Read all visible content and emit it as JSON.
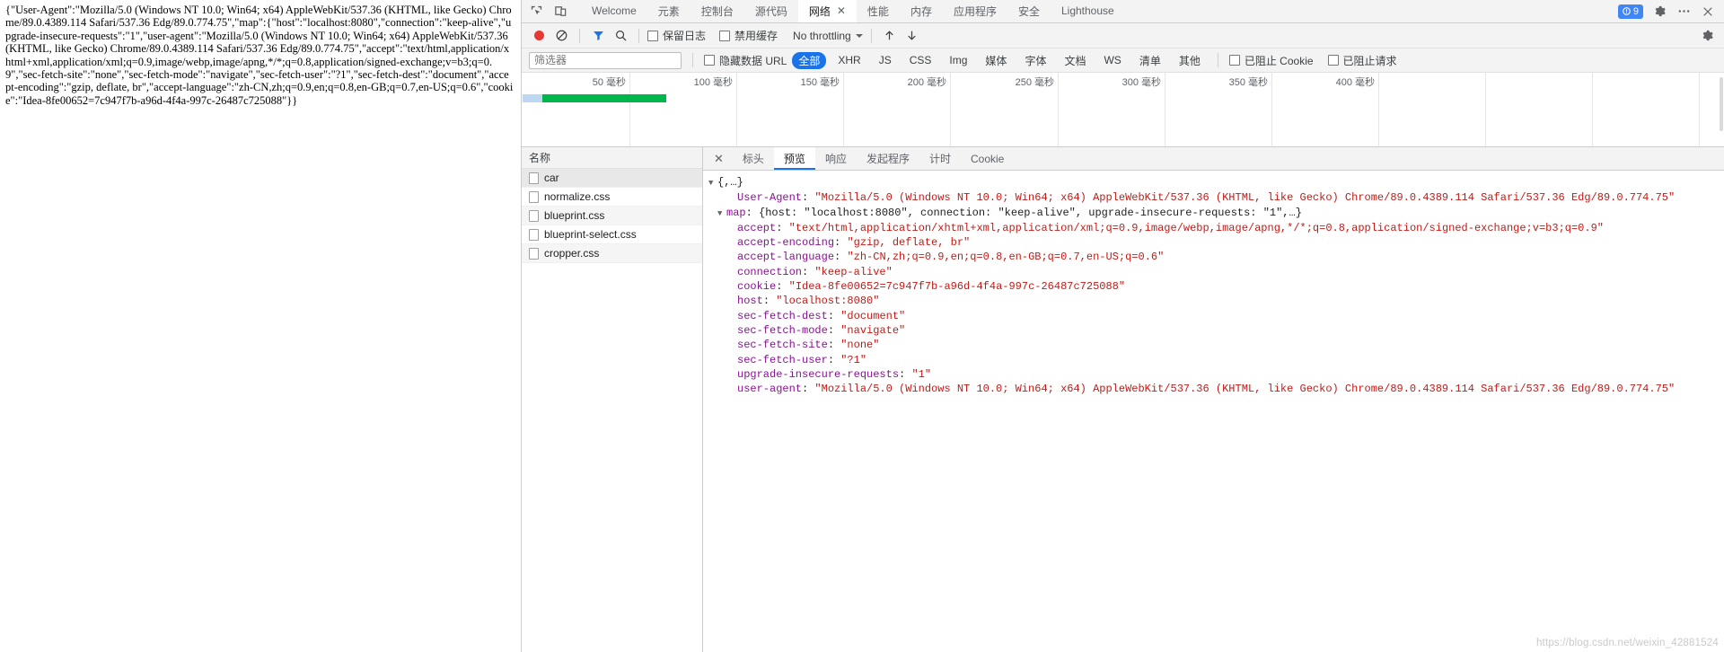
{
  "page": {
    "raw_json": "{\"User-Agent\":\"Mozilla/5.0 (Windows NT 10.0; Win64; x64) AppleWebKit/537.36 (KHTML, like Gecko) Chrome/89.0.4389.114 Safari/537.36 Edg/89.0.774.75\",\"map\":{\"host\":\"localhost:8080\",\"connection\":\"keep-alive\",\"upgrade-insecure-requests\":\"1\",\"user-agent\":\"Mozilla/5.0 (Windows NT 10.0; Win64; x64) AppleWebKit/537.36 (KHTML, like Gecko) Chrome/89.0.4389.114 Safari/537.36 Edg/89.0.774.75\",\"accept\":\"text/html,application/xhtml+xml,application/xml;q=0.9,image/webp,image/apng,*/*;q=0.8,application/signed-exchange;v=b3;q=0.9\",\"sec-fetch-site\":\"none\",\"sec-fetch-mode\":\"navigate\",\"sec-fetch-user\":\"?1\",\"sec-fetch-dest\":\"document\",\"accept-encoding\":\"gzip, deflate, br\",\"accept-language\":\"zh-CN,zh;q=0.9,en;q=0.8,en-GB;q=0.7,en-US;q=0.6\",\"cookie\":\"Idea-8fe00652=7c947f7b-a96d-4f4a-997c-26487c725088\"}}"
  },
  "devtools": {
    "tabs": [
      {
        "label": "Welcome",
        "active": false,
        "closable": false
      },
      {
        "label": "元素",
        "active": false,
        "closable": false
      },
      {
        "label": "控制台",
        "active": false,
        "closable": false
      },
      {
        "label": "源代码",
        "active": false,
        "closable": false
      },
      {
        "label": "网络",
        "active": true,
        "closable": true
      },
      {
        "label": "性能",
        "active": false,
        "closable": false
      },
      {
        "label": "内存",
        "active": false,
        "closable": false
      },
      {
        "label": "应用程序",
        "active": false,
        "closable": false
      },
      {
        "label": "安全",
        "active": false,
        "closable": false
      },
      {
        "label": "Lighthouse",
        "active": false,
        "closable": false
      }
    ],
    "tab_close_glyph": "✕",
    "warning_count": "9",
    "icons": {
      "inspect": "inspect-element-icon",
      "device": "device-toolbar-icon",
      "settings": "gear-icon",
      "customize": "more-options-icon",
      "close": "close-icon",
      "dock": "dock-icon"
    }
  },
  "network_toolbar": {
    "record_title": "记录",
    "clear_title": "清除",
    "filter_title": "筛选",
    "search_title": "搜索",
    "preserve_log_label": "保留日志",
    "disable_cache_label": "禁用缓存",
    "throttling_label": "No throttling",
    "import_title": "导入 HAR",
    "export_title": "导出 HAR",
    "settings_title": "网络设置"
  },
  "filter_bar": {
    "placeholder": "筛选器",
    "value": "",
    "hide_data_urls_label": "隐藏数据 URL",
    "types": [
      "全部",
      "XHR",
      "JS",
      "CSS",
      "Img",
      "媒体",
      "字体",
      "文档",
      "WS",
      "清单",
      "其他"
    ],
    "selected_type": "全部",
    "blocked_cookies_label": "已阻止 Cookie",
    "blocked_requests_label": "已阻止请求"
  },
  "overview": {
    "ticks": [
      "50 毫秒",
      "100 毫秒",
      "150 毫秒",
      "200 毫秒",
      "250 毫秒",
      "300 毫秒",
      "350 毫秒",
      "400 毫秒"
    ],
    "bars": [
      {
        "name": "waiting",
        "color": "#bdd6f2",
        "left_pct": 0.0,
        "width_pct": 2.6
      },
      {
        "name": "download",
        "color": "#00b54a",
        "left_pct": 2.6,
        "width_pct": 13.5
      }
    ]
  },
  "request_list": {
    "header": "名称",
    "rows": [
      {
        "name": "car",
        "selected": true
      },
      {
        "name": "normalize.css",
        "selected": false
      },
      {
        "name": "blueprint.css",
        "selected": false
      },
      {
        "name": "blueprint-select.css",
        "selected": false
      },
      {
        "name": "cropper.css",
        "selected": false
      }
    ]
  },
  "detail_panel": {
    "close_glyph": "✕",
    "tabs": [
      "标头",
      "预览",
      "响应",
      "发起程序",
      "计时",
      "Cookie"
    ],
    "active_tab": "预览",
    "preview": {
      "root_label": "{,…}",
      "lines": [
        {
          "indent": 1,
          "arrow": "",
          "key": "User-Agent",
          "value": "\"Mozilla/5.0 (Windows NT 10.0; Win64; x64) AppleWebKit/537.36 (KHTML, like Gecko) Chrome/89.0.4389.114 Safari/537.36 Edg/89.0.774.75\"",
          "type": "string"
        },
        {
          "indent": 0,
          "arrow": "▼",
          "key": "map",
          "value": "{host: \"localhost:8080\", connection: \"keep-alive\", upgrade-insecure-requests: \"1\",…}",
          "type": "object"
        },
        {
          "indent": 2,
          "arrow": "",
          "key": "accept",
          "value": "\"text/html,application/xhtml+xml,application/xml;q=0.9,image/webp,image/apng,*/*;q=0.8,application/signed-exchange;v=b3;q=0.9\"",
          "type": "string"
        },
        {
          "indent": 2,
          "arrow": "",
          "key": "accept-encoding",
          "value": "\"gzip, deflate, br\"",
          "type": "string"
        },
        {
          "indent": 2,
          "arrow": "",
          "key": "accept-language",
          "value": "\"zh-CN,zh;q=0.9,en;q=0.8,en-GB;q=0.7,en-US;q=0.6\"",
          "type": "string"
        },
        {
          "indent": 2,
          "arrow": "",
          "key": "connection",
          "value": "\"keep-alive\"",
          "type": "string"
        },
        {
          "indent": 2,
          "arrow": "",
          "key": "cookie",
          "value": "\"Idea-8fe00652=7c947f7b-a96d-4f4a-997c-26487c725088\"",
          "type": "string"
        },
        {
          "indent": 2,
          "arrow": "",
          "key": "host",
          "value": "\"localhost:8080\"",
          "type": "string"
        },
        {
          "indent": 2,
          "arrow": "",
          "key": "sec-fetch-dest",
          "value": "\"document\"",
          "type": "string"
        },
        {
          "indent": 2,
          "arrow": "",
          "key": "sec-fetch-mode",
          "value": "\"navigate\"",
          "type": "string"
        },
        {
          "indent": 2,
          "arrow": "",
          "key": "sec-fetch-site",
          "value": "\"none\"",
          "type": "string"
        },
        {
          "indent": 2,
          "arrow": "",
          "key": "sec-fetch-user",
          "value": "\"?1\"",
          "type": "string"
        },
        {
          "indent": 2,
          "arrow": "",
          "key": "upgrade-insecure-requests",
          "value": "\"1\"",
          "type": "string"
        },
        {
          "indent": 2,
          "arrow": "",
          "key": "user-agent",
          "value": "\"Mozilla/5.0 (Windows NT 10.0; Win64; x64) AppleWebKit/537.36 (KHTML, like Gecko) Chrome/89.0.4389.114 Safari/537.36 Edg/89.0.774.75\"",
          "type": "string"
        }
      ]
    }
  },
  "watermark": {
    "text": "https://blog.csdn.net/weixin_42881524"
  },
  "colors": {
    "accent": "#1a73e8",
    "record": "#e53935",
    "download_bar": "#00b54a",
    "waiting_bar": "#bdd6f2"
  }
}
